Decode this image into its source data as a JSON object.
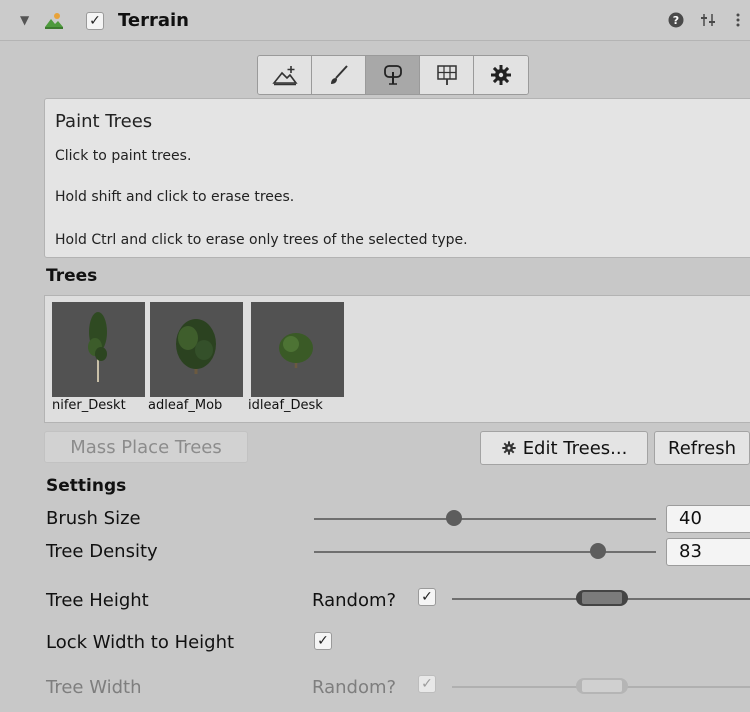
{
  "header": {
    "title": "Terrain",
    "enabled_check": "✓",
    "foldout": "▼",
    "help_icon": "help-icon",
    "settings_icon": "sliders-icon",
    "menu_icon": "kebab-menu-icon"
  },
  "toolbar": {
    "tools": [
      {
        "name": "create-neighbor-terrain-icon"
      },
      {
        "name": "paint-brush-icon"
      },
      {
        "name": "paint-trees-icon"
      },
      {
        "name": "paint-details-icon"
      },
      {
        "name": "terrain-settings-gear-icon"
      }
    ],
    "active_index": 2
  },
  "help": {
    "title": "Paint Trees",
    "lines": [
      "Click to paint trees.",
      "Hold shift and click to erase trees.",
      "Hold Ctrl and click to erase only trees of the selected type."
    ]
  },
  "trees": {
    "heading": "Trees",
    "items": [
      {
        "label": "nifer_Deskt"
      },
      {
        "label": "adleaf_Mob"
      },
      {
        "label": "idleaf_Desk"
      }
    ]
  },
  "buttons": {
    "mass_place": "Mass Place Trees",
    "edit_trees": "Edit Trees...",
    "refresh": "Refresh"
  },
  "settings": {
    "heading": "Settings",
    "brush_size": {
      "label": "Brush Size",
      "value": "40",
      "fraction": 0.41
    },
    "tree_density": {
      "label": "Tree Density",
      "value": "83",
      "fraction": 0.83
    },
    "tree_height": {
      "label": "Tree Height",
      "random_label": "Random?",
      "random_checked": "✓"
    },
    "lock_width": {
      "label": "Lock Width to Height",
      "checked": "✓"
    },
    "tree_width": {
      "label": "Tree Width",
      "random_label": "Random?",
      "random_checked": "✓"
    }
  },
  "colors": {
    "panel_bg": "#c8c8c8",
    "help_bg": "#e4e4e4",
    "thumb_bg": "#525252",
    "accent": "#5d5d5d"
  }
}
